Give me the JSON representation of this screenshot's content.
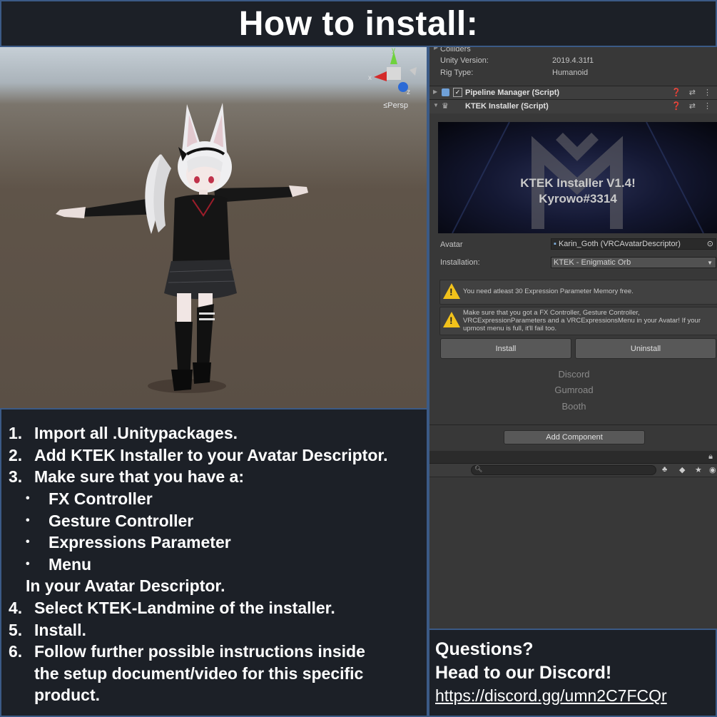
{
  "title": "How to install:",
  "viewport": {
    "persp_label": "≤Persp",
    "gizmo": {
      "y": "y",
      "x": "x",
      "z": "z"
    }
  },
  "instructions": {
    "steps": [
      {
        "num": "1.",
        "text": "Import all .Unitypackages."
      },
      {
        "num": "2.",
        "text": "Add KTEK Installer to your Avatar Descriptor."
      },
      {
        "num": "3.",
        "text": "Make sure that you have a:"
      }
    ],
    "bullets": [
      "FX Controller",
      "Gesture Controller",
      "Expressions Parameter",
      "Menu"
    ],
    "bullet_glyph": "•",
    "after_bullets": "In your Avatar Descriptor.",
    "steps2": [
      {
        "num": "4.",
        "text": "Select KTEK-Landmine of the installer."
      },
      {
        "num": "5.",
        "text": "Install."
      },
      {
        "num": "6.",
        "text": "Follow further possible instructions inside",
        "cont1": "the setup document/video for this specific",
        "cont2": "product."
      }
    ]
  },
  "inspector": {
    "colliders": "Colliders",
    "unity_version_label": "Unity Version:",
    "unity_version_value": "2019.4.31f1",
    "rig_type_label": "Rig Type:",
    "rig_type_value": "Humanoid",
    "pipeline_title": "Pipeline Manager (Script)",
    "installer_title": "KTEK Installer (Script)",
    "banner_line1": "KTEK Installer V1.4!",
    "banner_line2": "Kyrowo#3314",
    "avatar_label": "Avatar",
    "avatar_value": "Karin_Goth (VRCAvatarDescriptor)",
    "installation_label": "Installation:",
    "installation_value": "KTEK - Enigmatic Orb",
    "warning1": "You need atleast 30 Expression Parameter Memory free.",
    "warning2_l1": "Make sure that you got a FX Controller, Gesture Controller,",
    "warning2_l2": "VRCExpressionParameters and a VRCExpressionsMenu in your Avatar! If your",
    "warning2_l3": "upmost menu is full, it'll fail too.",
    "install_button": "Install",
    "uninstall_button": "Uninstall",
    "links": [
      "Discord",
      "Gumroad",
      "Booth"
    ],
    "add_component": "Add Component",
    "search_icon": "search-icon"
  },
  "questions": {
    "line1": "Questions?",
    "line2": "Head to our Discord!",
    "url": "https://discord.gg/umn2C7FCQr"
  },
  "colors": {
    "frame_border": "#3b5a86",
    "panel_bg": "#1c2027",
    "inspector_bg": "#383838",
    "warning": "#f2c21b"
  }
}
